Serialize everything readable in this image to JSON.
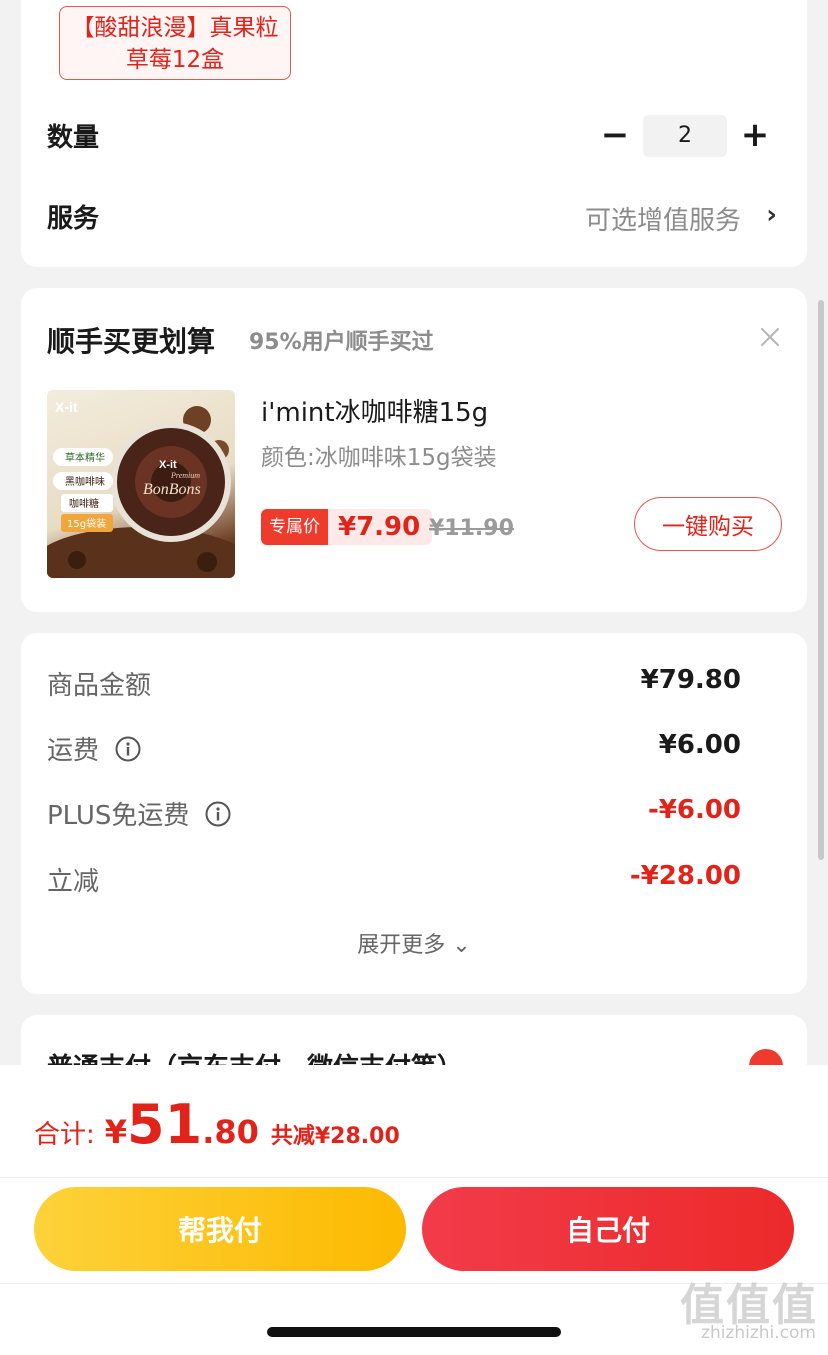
{
  "spec": {
    "variant_line1": "【酸甜浪漫】真果粒",
    "variant_line2": "草莓12盒",
    "qty_label": "数量",
    "qty_minus": "−",
    "qty_value": "2",
    "qty_plus": "+",
    "service_label": "服务",
    "service_value": "可选增值服务",
    "service_chevron": "›"
  },
  "addon": {
    "title": "顺手买更划算",
    "subtitle": "95%用户顺手买过",
    "product_name": "i'mint冰咖啡糖15g",
    "product_spec": "颜色:冰咖啡味15g袋装",
    "price_tag_label": "专属价",
    "price": "¥7.90",
    "original_price": "¥11.90",
    "buy_button": "一键购买",
    "image_text": {
      "brand": "X-it",
      "badge1": "草本精华",
      "badge2": "黑咖啡味",
      "badge3": "咖啡糖",
      "badge4": "15g袋装",
      "tin_brand": "X-it",
      "tin_text": "BonBons",
      "tin_premium": "Premium"
    }
  },
  "summary": {
    "rows": [
      {
        "label": "商品金额",
        "value": "¥79.80"
      },
      {
        "label": "运费",
        "value": "¥6.00"
      },
      {
        "label": "PLUS免运费",
        "value": "-¥6.00"
      },
      {
        "label": "立减",
        "value": "-¥28.00"
      }
    ],
    "expand": "展开更多 ⌄"
  },
  "payment": {
    "label": "普通支付（京东支付、微信支付等）"
  },
  "bottom": {
    "total_label": "合计:",
    "currency": "¥",
    "total_int": "51",
    "total_dec": ".80",
    "saved": "共减¥28.00",
    "help_pay": "帮我付",
    "self_pay": "自己付"
  },
  "watermark": {
    "logo": "值值值",
    "site": "zhizhizhi.com"
  },
  "colors": {
    "accent_red": "#e2231a",
    "help_pay_yellow": "#fdc21a",
    "self_pay_red": "#ef3333"
  }
}
